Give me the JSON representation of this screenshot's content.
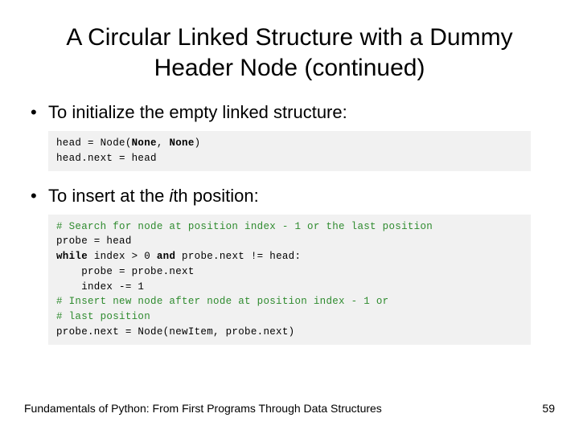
{
  "title": "A Circular Linked Structure with a Dummy Header Node (continued)",
  "bullets": {
    "b1": "To initialize the empty linked structure:",
    "b2_pre": "To insert at the ",
    "b2_ith_i": "i",
    "b2_ith_rest": "th",
    "b2_post": " position:"
  },
  "code1": {
    "l1a": "head = Node(",
    "l1b": "None",
    "l1c": ", ",
    "l1d": "None",
    "l1e": ")",
    "l2": "head.next = head"
  },
  "code2": {
    "c1": "# Search for node at position index - 1 or the last position",
    "l2": "probe = head",
    "l3a": "while",
    "l3b": " index > 0 ",
    "l3c": "and",
    "l3d": " probe.next != head:",
    "l4": "    probe = probe.next",
    "l5": "    index -= 1",
    "c2": "# Insert new node after node at position index - 1 or",
    "c3": "# last position",
    "l8": "probe.next = Node(newItem, probe.next)"
  },
  "footer": "Fundamentals of Python: From First Programs Through Data Structures",
  "page": "59",
  "chart_data": null
}
